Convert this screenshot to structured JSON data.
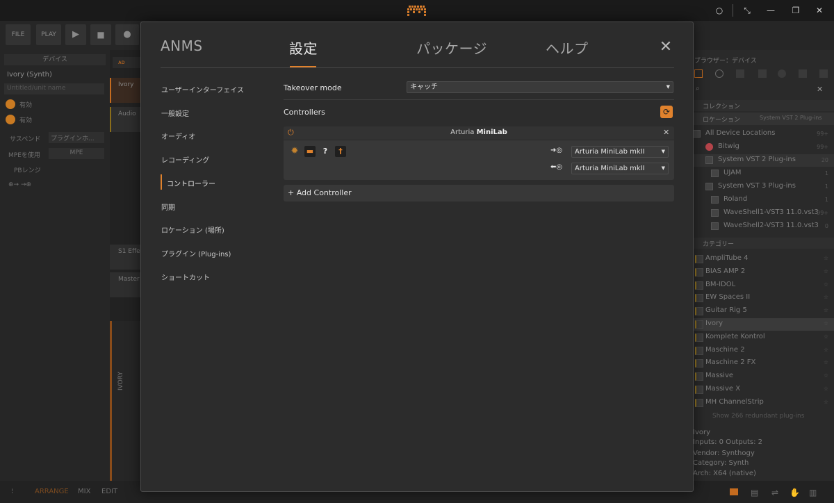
{
  "window": {
    "minimize_label": "—",
    "maximize_label": "❐",
    "close_label": "✕"
  },
  "toolbar": {
    "file_label": "FILE",
    "play_label": "PLAY"
  },
  "left_panel": {
    "header": "デバイス",
    "device_name": "Ivory (Synth)",
    "untitled_name": "Untitled/unit name",
    "enabled_1": "有効",
    "enabled_2": "有効",
    "dropdown_label": "サスペンド",
    "dropdown_value": "プラグインホ...",
    "mpe_label": "MPEを使用",
    "mpe_value": "MPE",
    "pb_label": "PBレンジ"
  },
  "tracks": {
    "t1": "Ivory",
    "t2": "Audio",
    "t3": "S1 Effe",
    "t4": "Master",
    "vertical": "IVORY"
  },
  "modal": {
    "tabs": [
      {
        "label": "ANMS"
      },
      {
        "label": "設定"
      },
      {
        "label": "パッケージ"
      },
      {
        "label": "ヘルプ"
      }
    ],
    "close": "✕",
    "nav": [
      "ユーザーインターフェイス",
      "一般設定",
      "オーディオ",
      "レコーディング",
      "コントローラー",
      "同期",
      "ロケーション (場所)",
      "プラグイン (Plug-ins)",
      "ショートカット"
    ],
    "takeover_label": "Takeover mode",
    "takeover_value": "キャッチ",
    "controllers_label": "Controllers",
    "controller": {
      "brand": "Arturia",
      "model": "MiniLab",
      "input_value": "Arturia MiniLab mkII",
      "output_value": "Arturia MiniLab mkII"
    },
    "add_controller": "Add Controller"
  },
  "right_panel": {
    "header": "ブラウザー：デバイス",
    "collection": "コレクション",
    "location": "ロケーション",
    "location_filter": "System VST 2 Plug-ins",
    "locations": [
      {
        "name": "All Device Locations",
        "count": "99+"
      },
      {
        "name": "Bitwig",
        "count": "99+"
      },
      {
        "name": "System VST 2 Plug-ins",
        "count": "20"
      },
      {
        "name": "UJAM",
        "count": "1"
      },
      {
        "name": "System VST 3 Plug-ins",
        "count": "1"
      },
      {
        "name": "Roland",
        "count": "1"
      },
      {
        "name": "WaveShell1-VST3 11.0.vst3",
        "count": "99+"
      },
      {
        "name": "WaveShell2-VST3 11.0.vst3",
        "count": "0"
      }
    ],
    "category": "カテゴリー",
    "plugins": [
      "AmpliTube 4",
      "BIAS AMP 2",
      "BM-IDOL",
      "EW Spaces II",
      "Guitar Rig 5",
      "Ivory",
      "Komplete Kontrol",
      "Maschine 2",
      "Maschine 2 FX",
      "Massive",
      "Massive X",
      "MH ChannelStrip"
    ],
    "show_more": "Show 266 redundant plug-ins",
    "info": {
      "name": "Ivory",
      "io": "Inputs: 0   Outputs: 2",
      "vendor": "Vendor: Synthogy",
      "category": "Category: Synth",
      "arch": "Arch: X64 (native)"
    }
  },
  "bottom": {
    "arrange": "ARRANGE",
    "mix": "MIX",
    "edit": "EDIT"
  },
  "colors": {
    "accent": "#e0822d"
  }
}
